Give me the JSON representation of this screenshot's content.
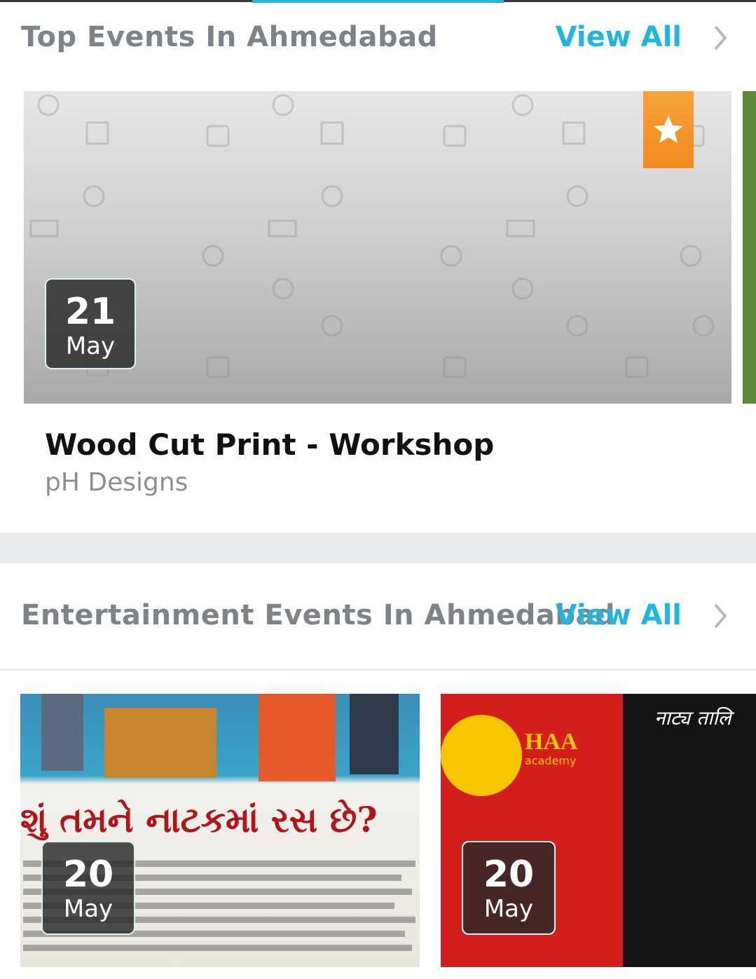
{
  "top_section": {
    "title": "Top Events In Ahmedabad",
    "view_all": "View All",
    "featured_event": {
      "date_day": "21",
      "date_month": "May",
      "title": "Wood Cut Print - Workshop",
      "organizer": "pH Designs",
      "featured_icon": "star-icon"
    }
  },
  "entertainment_section": {
    "title": "Entertainment Events In Ahmedabad",
    "view_all": "View All",
    "events": [
      {
        "date_day": "20",
        "date_month": "May",
        "poster_headline": "શું તમને નાટકમાં રસ છે?"
      },
      {
        "date_day": "20",
        "date_month": "May",
        "poster_logo_text": "HAA",
        "poster_logo_sub": "academy",
        "poster_heading": "नाट्य तालि"
      }
    ]
  },
  "colors": {
    "accent": "#1fb6e0",
    "featured_badge": "#f39a2a",
    "header_text": "#7d8389"
  }
}
